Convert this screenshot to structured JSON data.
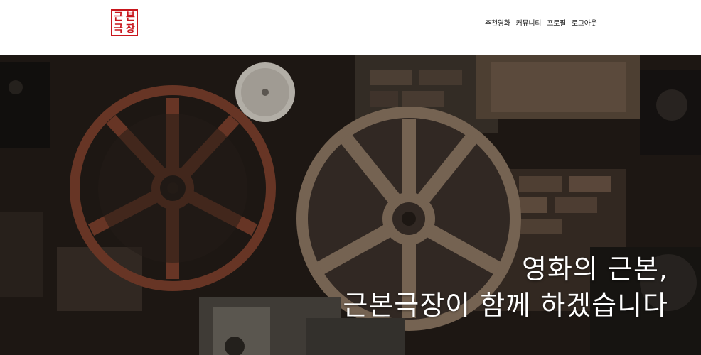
{
  "header": {
    "logo_chars": [
      "근",
      "본",
      "극",
      "장"
    ],
    "nav": [
      {
        "label": "추천영화"
      },
      {
        "label": "커뮤니티"
      },
      {
        "label": "프로필"
      },
      {
        "label": "로그아웃"
      }
    ]
  },
  "hero": {
    "headline_line1": "영화의 근본,",
    "headline_line2": "근본극장이 함께 하겠습니다"
  },
  "colors": {
    "brand_red": "#c8161d",
    "header_bg": "#ffffff",
    "hero_text": "#ffffff"
  }
}
